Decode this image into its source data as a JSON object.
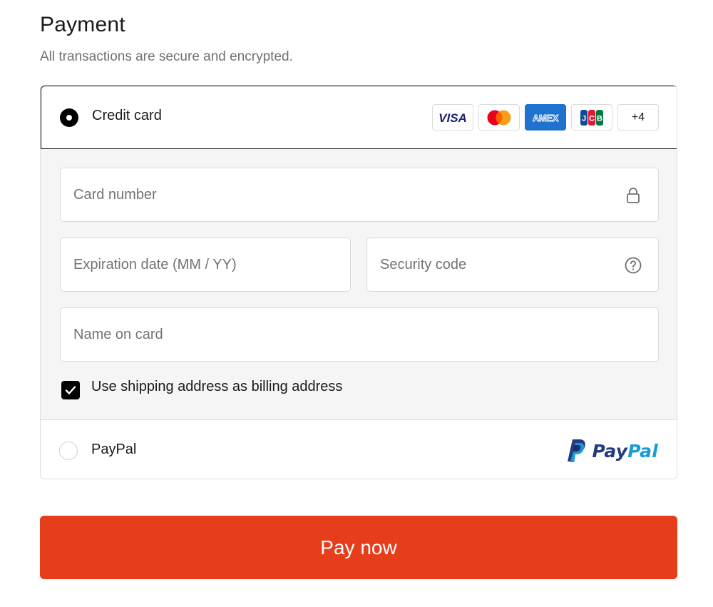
{
  "header": {
    "title": "Payment",
    "subtitle": "All transactions are secure and encrypted."
  },
  "payment_options": {
    "credit_card": {
      "label": "Credit card",
      "selected": true,
      "card_brands": [
        "visa-icon",
        "mastercard-icon",
        "amex-icon",
        "jcb-icon"
      ],
      "more_brands": "+4"
    },
    "paypal": {
      "label": "PayPal",
      "selected": false,
      "logo_text_pay": "Pay",
      "logo_text_pal": "Pal"
    }
  },
  "form": {
    "card_number": {
      "placeholder": "Card number",
      "value": "",
      "icon": "lock-icon"
    },
    "expiration": {
      "placeholder": "Expiration date (MM / YY)",
      "value": ""
    },
    "security_code": {
      "placeholder": "Security code",
      "value": "",
      "icon": "help-circle-icon"
    },
    "name_on_card": {
      "placeholder": "Name on card",
      "value": ""
    },
    "billing_checkbox": {
      "label": "Use shipping address as billing address",
      "checked": true
    }
  },
  "actions": {
    "pay_now": "Pay now"
  },
  "colors": {
    "pay_button": "#e63d1b",
    "form_background": "#f5f5f5",
    "selected_radio": "#000000",
    "paypal_dark_blue": "#253b80",
    "paypal_light_blue": "#179bd7",
    "amex_blue": "#1f72cd"
  }
}
